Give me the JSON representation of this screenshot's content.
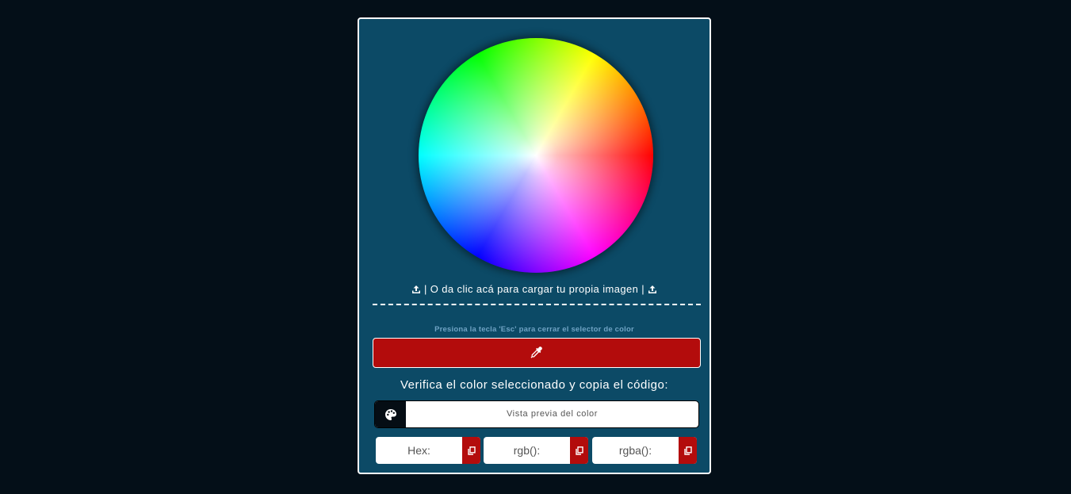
{
  "upload": {
    "label": " | O da clic acá para cargar tu propia imagen | "
  },
  "hint": {
    "esc": "Presiona la tecla 'Esc' para cerrar el selector de color"
  },
  "verify": {
    "title": "Verifica el color seleccionado y copia el código:"
  },
  "preview": {
    "label": "Vista previa del color",
    "swatch_color": "#050d14"
  },
  "codes": [
    {
      "label": "Hex:"
    },
    {
      "label": "rgb():"
    },
    {
      "label": "rgba():"
    }
  ],
  "colors": {
    "panel": "#0c4a66",
    "accent": "#b30c0c",
    "background": "#040f18"
  },
  "icons": {
    "upload": "upload-icon",
    "picker": "eyedropper-icon",
    "preview": "palette-icon",
    "copy": "copy-icon"
  }
}
